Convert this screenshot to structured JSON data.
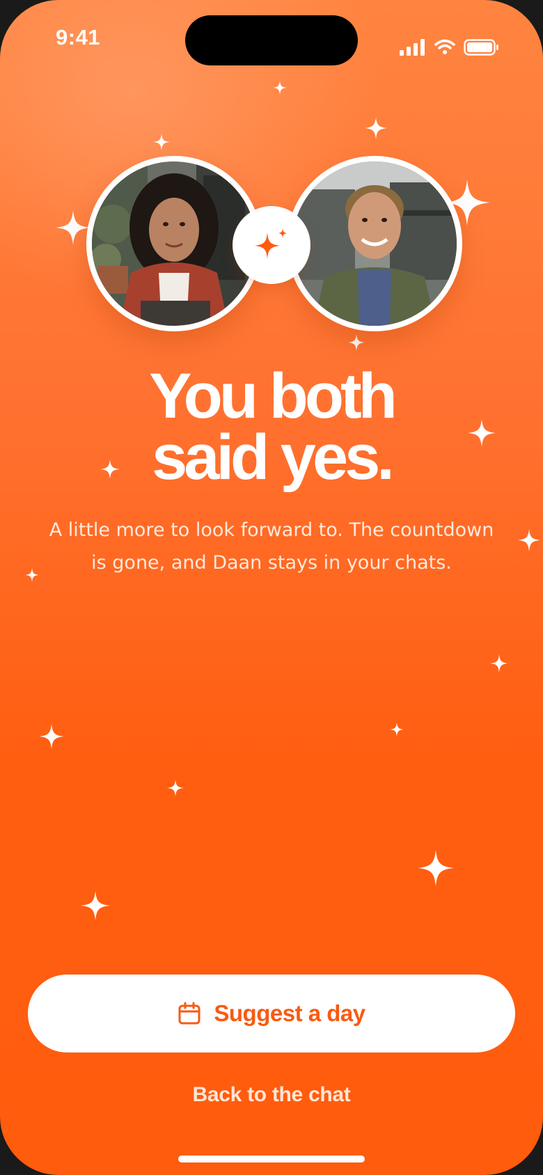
{
  "status_bar": {
    "time": "9:41"
  },
  "match": {
    "left_person_alt": "Photo of you",
    "right_person_alt": "Photo of Daan"
  },
  "headline": {
    "line1": "You both",
    "line2": "said yes."
  },
  "subtext": "A little more to look forward to. The countdown is gone, and Daan stays in your chats.",
  "actions": {
    "primary_label": "Suggest a day",
    "secondary_label": "Back to the chat"
  },
  "colors": {
    "accent": "#ff5c0e",
    "background_top": "#ff8440",
    "background_bottom": "#ff5c0e",
    "button_bg": "#ffffff",
    "button_text": "#f85a12"
  },
  "icons": {
    "primary_button": "calendar-icon",
    "badge": "sparkle-icon",
    "status": [
      "cellular-signal-icon",
      "wifi-icon",
      "battery-icon"
    ]
  }
}
